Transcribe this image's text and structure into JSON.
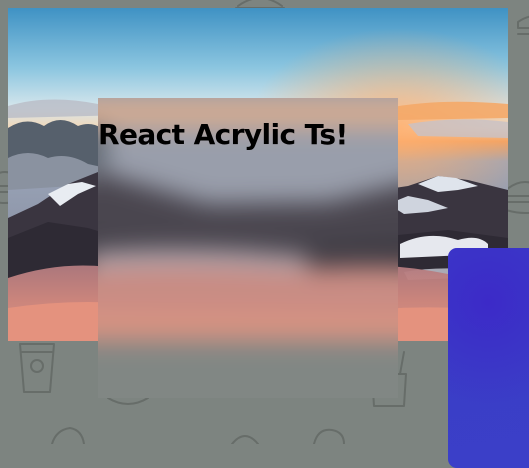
{
  "window": {
    "heading": "React Acrylic Ts!"
  },
  "colors": {
    "page_background": "#7d8480",
    "pattern_stroke": "#676d69",
    "blue_card": "#3a3ac8",
    "sky_top": "#3f92c4",
    "sunset_orange": "#f0a060",
    "mountain_dark": "#3a3540",
    "cloud_pink": "#d48a80"
  },
  "icons": {
    "background_pattern": [
      "burger-icon",
      "cup-icon",
      "pizza-slice-icon",
      "taco-icon",
      "fries-icon",
      "dessert-icon"
    ]
  }
}
